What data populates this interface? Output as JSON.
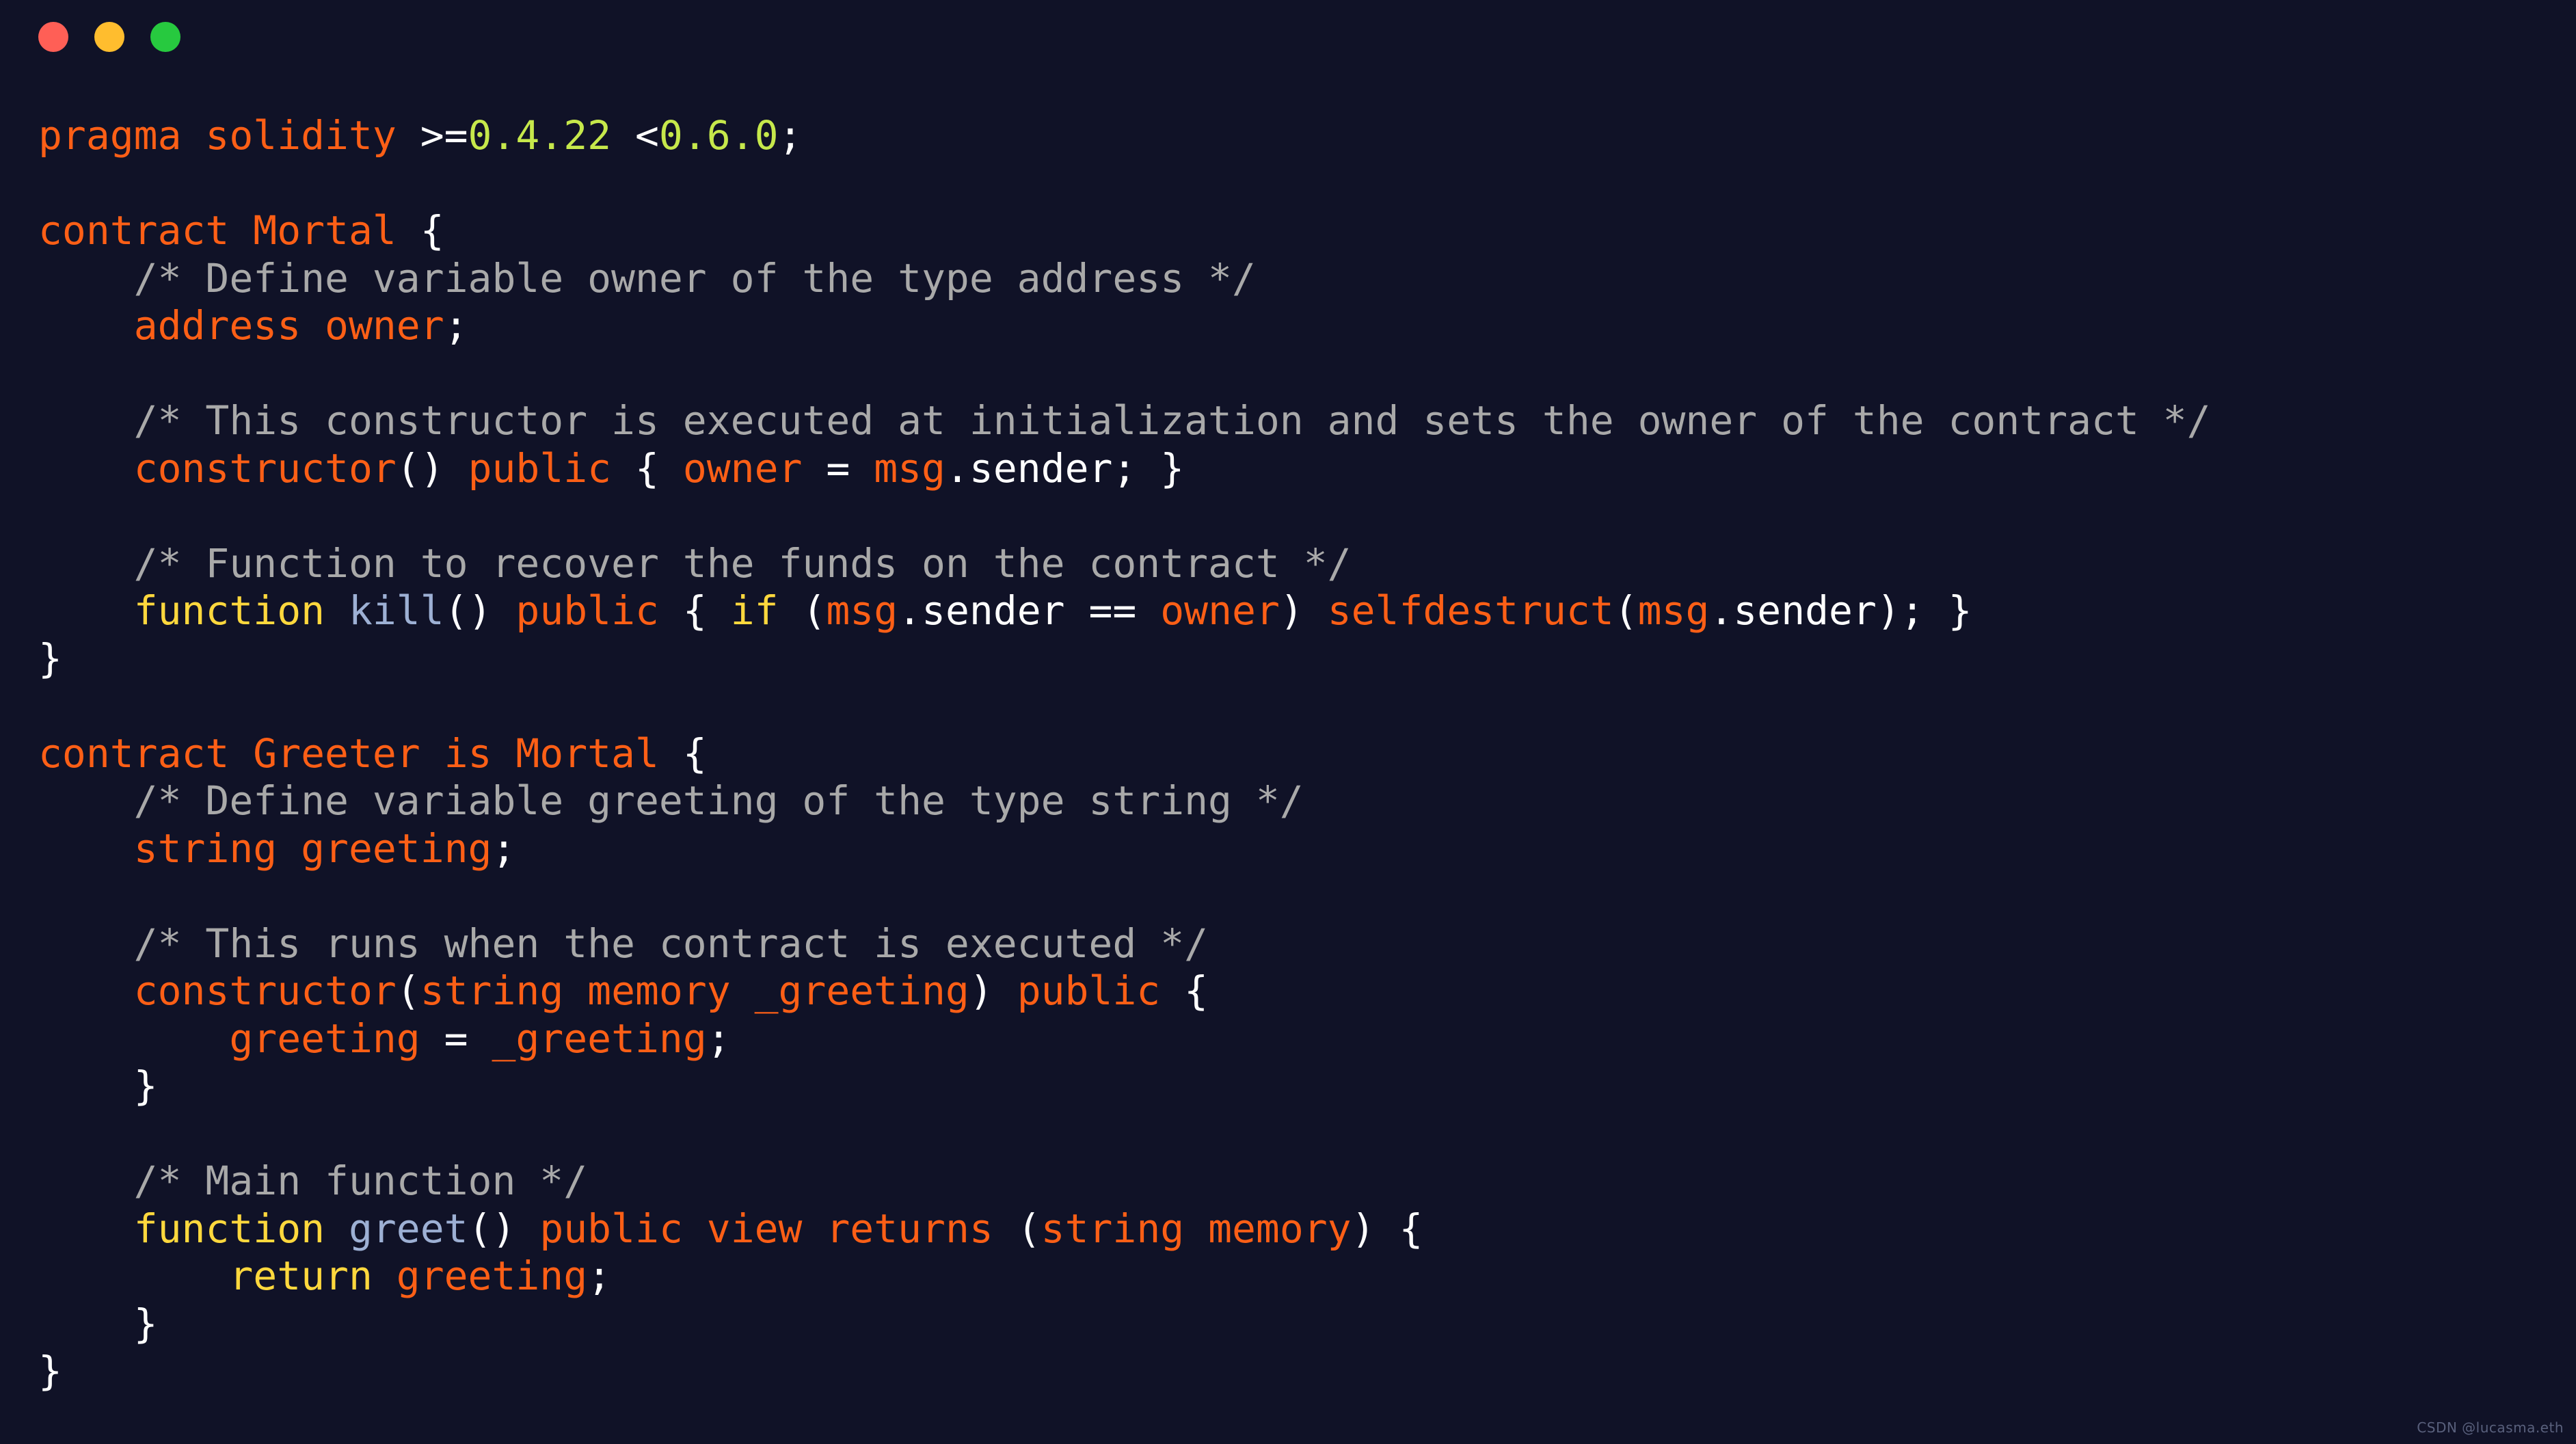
{
  "window": {
    "titlebar": {
      "buttons": [
        {
          "name": "close-button",
          "icon": "close-dot",
          "color": "#ff5f56"
        },
        {
          "name": "minimize-button",
          "icon": "minimize-dot",
          "color": "#ffbd2e"
        },
        {
          "name": "maximize-button",
          "icon": "maximize-dot",
          "color": "#27c93f"
        }
      ]
    }
  },
  "watermark": {
    "text": "CSDN @lucasma.eth"
  },
  "colors": {
    "background": "#101227",
    "keyword": "#fd5f16",
    "punctuation": "#ffffff",
    "number": "#c6e84b",
    "comment": "#a9a9a9",
    "function_keyword": "#ffd83d",
    "function_name": "#9db0d4"
  },
  "code": {
    "language": "solidity",
    "lines": [
      {
        "n": 1,
        "tokens": [
          {
            "t": "pragma solidity ",
            "c": "kw"
          },
          {
            "t": ">=",
            "c": "punct"
          },
          {
            "t": "0.4.22",
            "c": "num"
          },
          {
            "t": " <",
            "c": "punct"
          },
          {
            "t": "0.6.0",
            "c": "num"
          },
          {
            "t": ";",
            "c": "punct"
          }
        ]
      },
      {
        "n": 2,
        "tokens": []
      },
      {
        "n": 3,
        "tokens": [
          {
            "t": "contract Mortal ",
            "c": "kw"
          },
          {
            "t": "{",
            "c": "punct"
          }
        ]
      },
      {
        "n": 4,
        "tokens": [
          {
            "t": "    /* Define variable owner of the type address */",
            "c": "cmt"
          }
        ]
      },
      {
        "n": 5,
        "tokens": [
          {
            "t": "    ",
            "c": "punct"
          },
          {
            "t": "address owner",
            "c": "kw"
          },
          {
            "t": ";",
            "c": "punct"
          }
        ]
      },
      {
        "n": 6,
        "tokens": []
      },
      {
        "n": 7,
        "tokens": [
          {
            "t": "    /* This constructor is executed at initialization and sets the owner of the contract */",
            "c": "cmt"
          }
        ]
      },
      {
        "n": 8,
        "tokens": [
          {
            "t": "    ",
            "c": "punct"
          },
          {
            "t": "constructor",
            "c": "kw"
          },
          {
            "t": "() ",
            "c": "punct"
          },
          {
            "t": "public",
            "c": "kw"
          },
          {
            "t": " { ",
            "c": "punct"
          },
          {
            "t": "owner",
            "c": "kw"
          },
          {
            "t": " = ",
            "c": "punct"
          },
          {
            "t": "msg",
            "c": "kw"
          },
          {
            "t": ".sender; }",
            "c": "punct"
          }
        ]
      },
      {
        "n": 9,
        "tokens": []
      },
      {
        "n": 10,
        "tokens": [
          {
            "t": "    /* Function to recover the funds on the contract */",
            "c": "cmt"
          }
        ]
      },
      {
        "n": 11,
        "tokens": [
          {
            "t": "    ",
            "c": "punct"
          },
          {
            "t": "function",
            "c": "fn"
          },
          {
            "t": " ",
            "c": "punct"
          },
          {
            "t": "kill",
            "c": "name"
          },
          {
            "t": "() ",
            "c": "punct"
          },
          {
            "t": "public",
            "c": "kw"
          },
          {
            "t": " { ",
            "c": "punct"
          },
          {
            "t": "if",
            "c": "fn"
          },
          {
            "t": " (",
            "c": "punct"
          },
          {
            "t": "msg",
            "c": "kw"
          },
          {
            "t": ".sender == ",
            "c": "punct"
          },
          {
            "t": "owner",
            "c": "kw"
          },
          {
            "t": ") ",
            "c": "punct"
          },
          {
            "t": "selfdestruct",
            "c": "kw"
          },
          {
            "t": "(",
            "c": "punct"
          },
          {
            "t": "msg",
            "c": "kw"
          },
          {
            "t": ".sender); }",
            "c": "punct"
          }
        ]
      },
      {
        "n": 12,
        "tokens": [
          {
            "t": "}",
            "c": "punct"
          }
        ]
      },
      {
        "n": 13,
        "tokens": []
      },
      {
        "n": 14,
        "tokens": [
          {
            "t": "contract Greeter is Mortal ",
            "c": "kw"
          },
          {
            "t": "{",
            "c": "punct"
          }
        ]
      },
      {
        "n": 15,
        "tokens": [
          {
            "t": "    /* Define variable greeting of the type string */",
            "c": "cmt"
          }
        ]
      },
      {
        "n": 16,
        "tokens": [
          {
            "t": "    ",
            "c": "punct"
          },
          {
            "t": "string greeting",
            "c": "kw"
          },
          {
            "t": ";",
            "c": "punct"
          }
        ]
      },
      {
        "n": 17,
        "tokens": []
      },
      {
        "n": 18,
        "tokens": [
          {
            "t": "    /* This runs when the contract is executed */",
            "c": "cmt"
          }
        ]
      },
      {
        "n": 19,
        "tokens": [
          {
            "t": "    ",
            "c": "punct"
          },
          {
            "t": "constructor",
            "c": "kw"
          },
          {
            "t": "(",
            "c": "punct"
          },
          {
            "t": "string memory _greeting",
            "c": "kw"
          },
          {
            "t": ") ",
            "c": "punct"
          },
          {
            "t": "public",
            "c": "kw"
          },
          {
            "t": " {",
            "c": "punct"
          }
        ]
      },
      {
        "n": 20,
        "tokens": [
          {
            "t": "        ",
            "c": "punct"
          },
          {
            "t": "greeting",
            "c": "kw"
          },
          {
            "t": " = ",
            "c": "punct"
          },
          {
            "t": "_greeting",
            "c": "kw"
          },
          {
            "t": ";",
            "c": "punct"
          }
        ]
      },
      {
        "n": 21,
        "tokens": [
          {
            "t": "    }",
            "c": "punct"
          }
        ]
      },
      {
        "n": 22,
        "tokens": []
      },
      {
        "n": 23,
        "tokens": [
          {
            "t": "    /* Main function */",
            "c": "cmt"
          }
        ]
      },
      {
        "n": 24,
        "tokens": [
          {
            "t": "    ",
            "c": "punct"
          },
          {
            "t": "function",
            "c": "fn"
          },
          {
            "t": " ",
            "c": "punct"
          },
          {
            "t": "greet",
            "c": "name"
          },
          {
            "t": "() ",
            "c": "punct"
          },
          {
            "t": "public view returns",
            "c": "kw"
          },
          {
            "t": " (",
            "c": "punct"
          },
          {
            "t": "string memory",
            "c": "kw"
          },
          {
            "t": ") {",
            "c": "punct"
          }
        ]
      },
      {
        "n": 25,
        "tokens": [
          {
            "t": "        ",
            "c": "punct"
          },
          {
            "t": "return",
            "c": "fn"
          },
          {
            "t": " ",
            "c": "punct"
          },
          {
            "t": "greeting",
            "c": "kw"
          },
          {
            "t": ";",
            "c": "punct"
          }
        ]
      },
      {
        "n": 26,
        "tokens": [
          {
            "t": "    }",
            "c": "punct"
          }
        ]
      },
      {
        "n": 27,
        "tokens": [
          {
            "t": "}",
            "c": "punct"
          }
        ]
      }
    ]
  }
}
